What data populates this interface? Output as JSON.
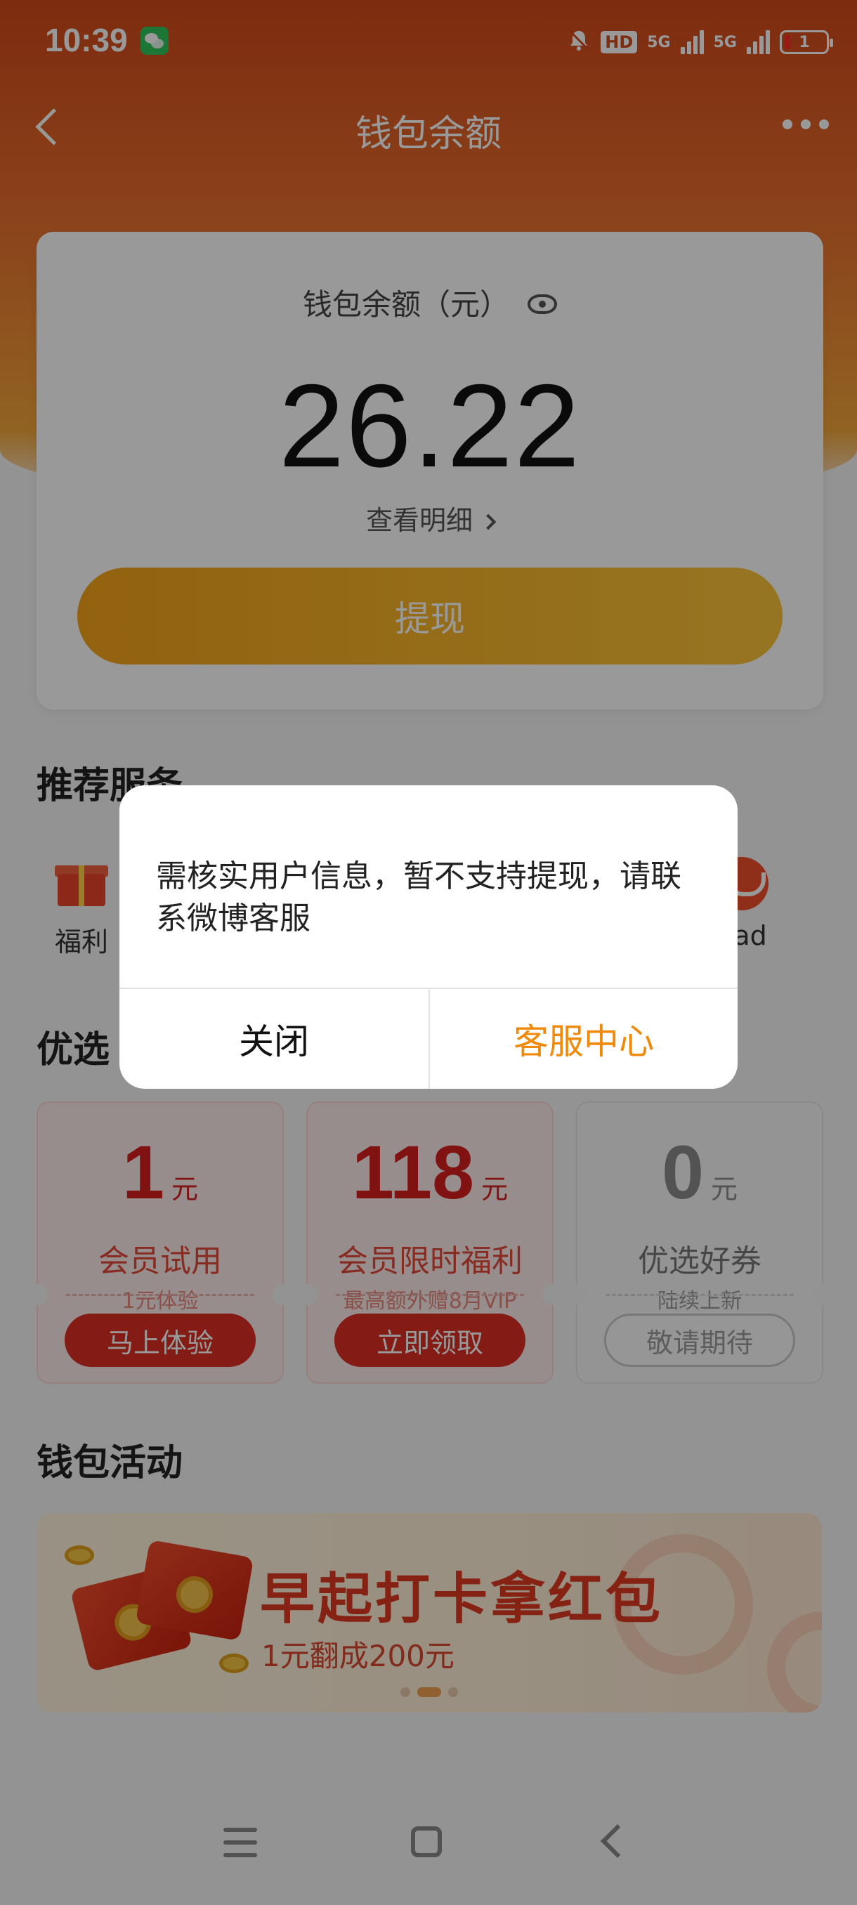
{
  "status_bar": {
    "time": "10:39",
    "network_1": "5G",
    "network_2": "5G",
    "hd_badge": "HD",
    "battery_level": "1",
    "icons": [
      "wechat-icon",
      "bell-muted-icon",
      "signal-icon",
      "battery-icon"
    ]
  },
  "nav": {
    "title": "钱包余额",
    "back_icon": "chevron-left-icon",
    "more_icon": "more-dots-icon"
  },
  "balance": {
    "label": "钱包余额（元）",
    "value": "26.22",
    "detail_link": "查看明细",
    "withdraw_button": "提现"
  },
  "services": {
    "title": "推荐服务",
    "items": [
      {
        "label": "福利",
        "icon": "gift-icon"
      },
      {
        "label": "pad",
        "icon": "red-circle-icon"
      }
    ]
  },
  "coupons": {
    "title": "优选",
    "items": [
      {
        "amount": "1",
        "unit": "元",
        "name": "会员试用",
        "sub": "1元体验",
        "button": "马上体验",
        "style": "red"
      },
      {
        "amount": "118",
        "unit": "元",
        "name": "会员限时福利",
        "sub": "最高额外赠8月VIP",
        "button": "立即领取",
        "style": "red"
      },
      {
        "amount": "0",
        "unit": "元",
        "name": "优选好券",
        "sub": "陆续上新",
        "button": "敬请期待",
        "style": "gray"
      }
    ]
  },
  "activities": {
    "title": "钱包活动",
    "banner_title": "早起打卡拿红包",
    "banner_subtitle": "1元翻成200元",
    "active_dot": 1,
    "dot_count": 3
  },
  "dialog": {
    "message": "需核实用户信息，暂不支持提现，请联系微博客服",
    "close_button": "关闭",
    "service_button": "客服中心"
  },
  "colors": {
    "header_orange": "#e9722e",
    "withdraw_button": "#f7b127",
    "accent_red": "#d81e1e",
    "dialog_accent": "#f08a0c"
  }
}
